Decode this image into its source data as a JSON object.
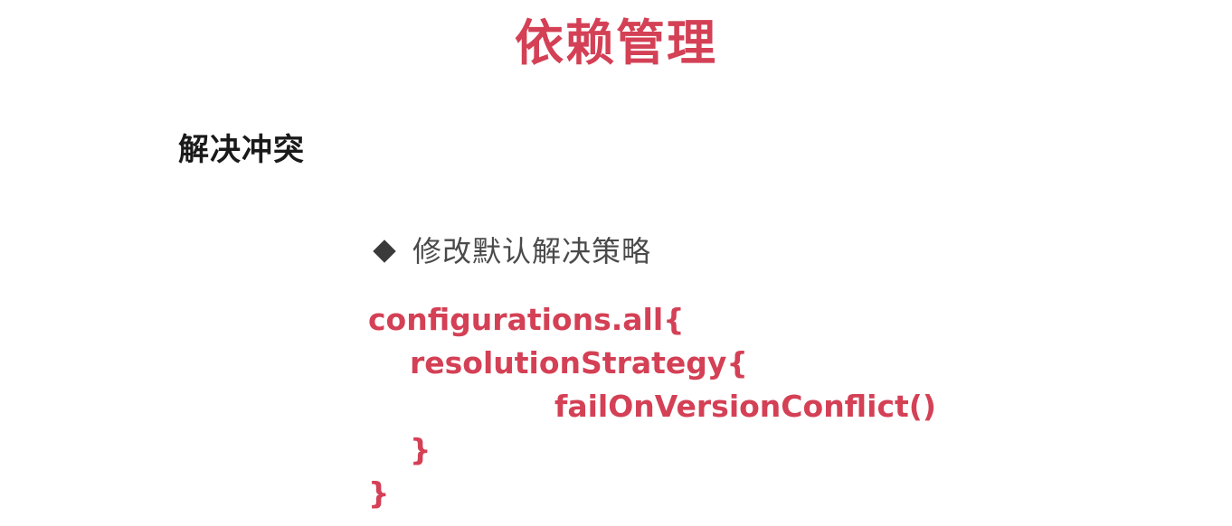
{
  "slide": {
    "title": "依赖管理",
    "section_heading": "解决冲突",
    "bullet": {
      "icon": "diamond-bullet-icon",
      "text": "修改默认解决策略"
    },
    "code_lines": [
      "configurations.all{",
      "resolutionStrategy{",
      "failOnVersionConflict()",
      "}",
      "}"
    ],
    "colors": {
      "accent": "#d44055",
      "heading": "#1a1a1a",
      "body_text": "#4a4a4a",
      "background": "#ffffff"
    }
  }
}
